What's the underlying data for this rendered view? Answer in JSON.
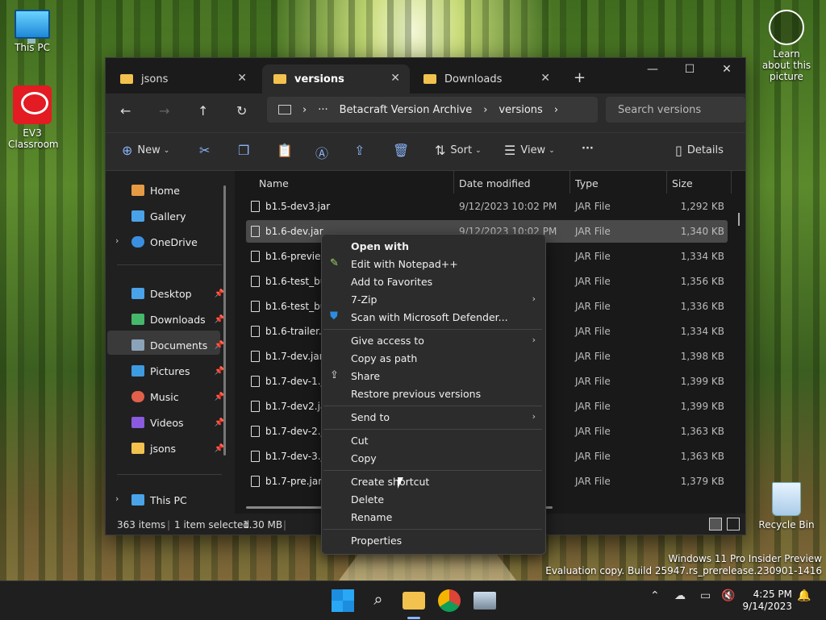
{
  "desktop": {
    "this_pc": "This PC",
    "ev3": "EV3 Classroom",
    "recycle_bin": "Recycle Bin",
    "learn": "Learn about this picture"
  },
  "explorer": {
    "tabs": [
      {
        "label": "jsons"
      },
      {
        "label": "versions"
      },
      {
        "label": "Downloads"
      }
    ],
    "breadcrumb": {
      "ellipsis": "···",
      "part1": "Betacraft Version Archive",
      "part2": "versions"
    },
    "search_placeholder": "Search versions",
    "toolbar": {
      "new": "New",
      "sort": "Sort",
      "view": "View",
      "details": "Details",
      "more": "···"
    },
    "sidebar": {
      "home": "Home",
      "gallery": "Gallery",
      "onedrive": "OneDrive",
      "desktop": "Desktop",
      "downloads": "Downloads",
      "documents": "Documents",
      "pictures": "Pictures",
      "music": "Music",
      "videos": "Videos",
      "jsons": "jsons",
      "this_pc": "This PC"
    },
    "columns": {
      "name": "Name",
      "date": "Date modified",
      "type": "Type",
      "size": "Size"
    },
    "rows": [
      {
        "name": "b1.5-dev3.jar",
        "date": "9/12/2023 10:02 PM",
        "type": "JAR File",
        "size": "1,292 KB"
      },
      {
        "name": "b1.6-dev.jar",
        "date": "9/12/2023 10:02 PM",
        "type": "JAR File",
        "size": "1,340 KB"
      },
      {
        "name": "b1.6-preview.",
        "date": "",
        "type": "JAR File",
        "size": "1,334 KB"
      },
      {
        "name": "b1.6-test_buil",
        "date": "",
        "type": "JAR File",
        "size": "1,356 KB"
      },
      {
        "name": "b1.6-test_buil",
        "date": "",
        "type": "JAR File",
        "size": "1,336 KB"
      },
      {
        "name": "b1.6-trailer.ja",
        "date": "",
        "type": "JAR File",
        "size": "1,334 KB"
      },
      {
        "name": "b1.7-dev.jar",
        "date": "",
        "type": "JAR File",
        "size": "1,398 KB"
      },
      {
        "name": "b1.7-dev-1.ja",
        "date": "",
        "type": "JAR File",
        "size": "1,399 KB"
      },
      {
        "name": "b1.7-dev2.jar",
        "date": "",
        "type": "JAR File",
        "size": "1,399 KB"
      },
      {
        "name": "b1.7-dev-2.ja",
        "date": "",
        "type": "JAR File",
        "size": "1,363 KB"
      },
      {
        "name": "b1.7-dev-3.ja",
        "date": "",
        "type": "JAR File",
        "size": "1,363 KB"
      },
      {
        "name": "b1.7-pre.jar",
        "date": "",
        "type": "JAR File",
        "size": "1,379 KB"
      }
    ],
    "status": {
      "count": "363 items",
      "selected": "1 item selected",
      "size": "1.30 MB"
    }
  },
  "context_menu": {
    "open_with": "Open with",
    "notepad": "Edit with Notepad++",
    "favorites": "Add to Favorites",
    "zip": "7-Zip",
    "defender": "Scan with Microsoft Defender...",
    "give_access": "Give access to",
    "copy_path": "Copy as path",
    "share": "Share",
    "restore": "Restore previous versions",
    "send_to": "Send to",
    "cut": "Cut",
    "copy": "Copy",
    "shortcut": "Create shortcut",
    "delete": "Delete",
    "rename": "Rename",
    "properties": "Properties"
  },
  "watermark": {
    "line1": "Windows 11 Pro Insider Preview",
    "line2": "Evaluation copy. Build 25947.rs_prerelease.230901-1416"
  },
  "clock": {
    "time": "4:25 PM",
    "date": "9/14/2023"
  }
}
